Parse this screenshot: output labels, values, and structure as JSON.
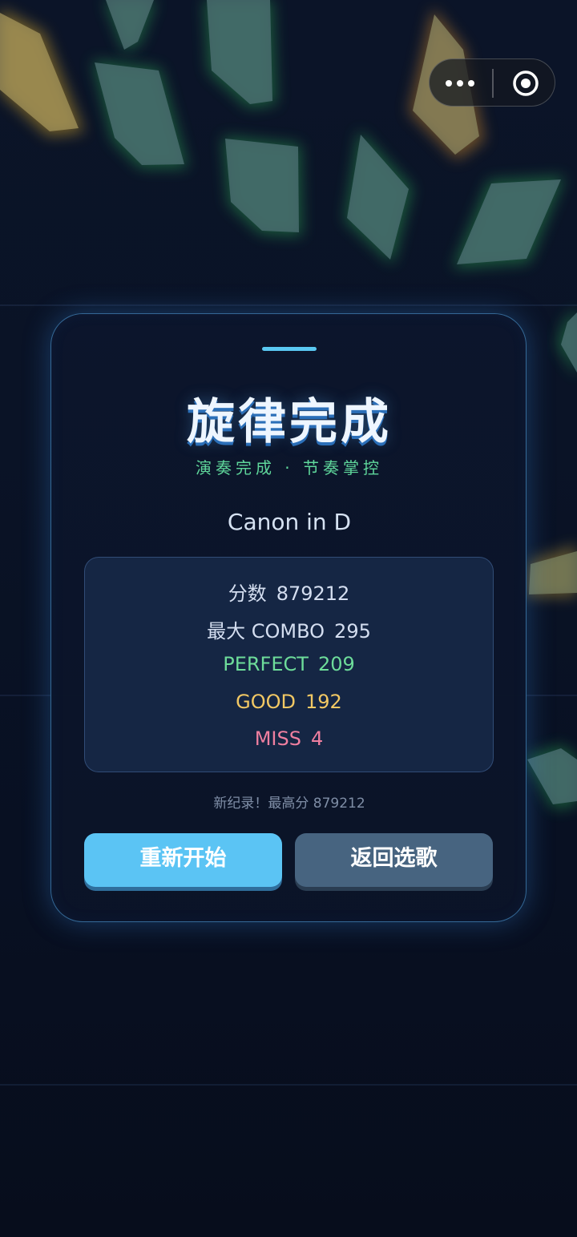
{
  "result_panel": {
    "title": "旋律完成",
    "subtitle": "演奏完成 · 节奏掌控",
    "song_name": "Canon in D",
    "stats": {
      "score_label": "分数",
      "score_value": "879212",
      "combo_label": "最大 COMBO",
      "combo_value": "295",
      "perfect_label": "PERFECT",
      "perfect_value": "209",
      "good_label": "GOOD",
      "good_value": "192",
      "miss_label": "MISS",
      "miss_value": "4"
    },
    "record_text": "新纪录！最高分 879212",
    "restart_label": "重新开始",
    "back_label": "返回选歌"
  },
  "capsule": {
    "more_icon": "more-dots-icon",
    "close_icon": "target-circle-icon"
  },
  "colors": {
    "perfect": "#6ddc9a",
    "good": "#f2c864",
    "miss": "#ef7fa0",
    "accent": "#5bc4f4"
  }
}
